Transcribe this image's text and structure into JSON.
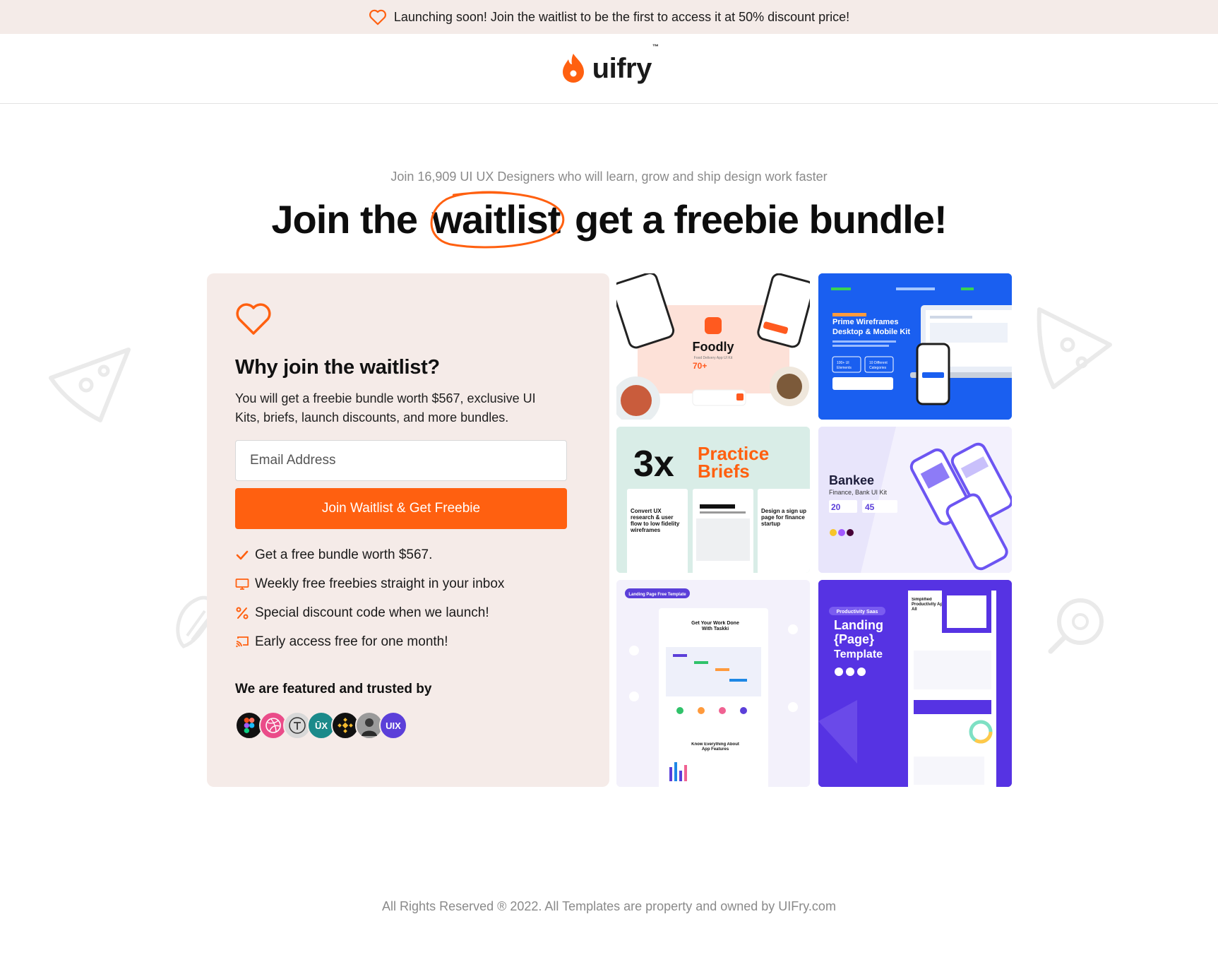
{
  "announcement": {
    "text": "Launching soon! Join the waitlist to be the first to access it at 50% discount price!",
    "icon": "heart-outline-icon"
  },
  "brand": {
    "name": "uifry",
    "trademark": "™",
    "accent": "#ff6010"
  },
  "hero": {
    "subline": "Join 16,909 UI UX Designers who will learn, grow and ship design work faster",
    "headline_before": "Join the",
    "headline_circled": "waitlist",
    "headline_after": "get a freebie bundle!"
  },
  "signup": {
    "heading": "Why join the waitlist?",
    "description": "You will get a freebie bundle worth $567, exclusive UI Kits, briefs, launch discounts, and more bundles.",
    "email_placeholder": "Email Address",
    "email_value": "",
    "button_label": "Join Waitlist & Get Freebie",
    "perks": [
      {
        "icon": "check-icon",
        "text": "Get a free bundle worth $567."
      },
      {
        "icon": "monitor-icon",
        "text": "Weekly free freebies straight in your inbox"
      },
      {
        "icon": "percent-icon",
        "text": "Special discount code when we launch!"
      },
      {
        "icon": "cast-icon",
        "text": "Early access free for one month!"
      }
    ],
    "featured_heading": "We are featured and trusted by",
    "featured_logos": [
      "figma",
      "dribbble",
      "typography",
      "ux",
      "binance",
      "person",
      "uix"
    ],
    "featured_uix_text": "UIX",
    "featured_ux_text": "ŪX"
  },
  "previews": {
    "foodly": {
      "title": "Foodly",
      "subtitle": "Food Delivery App UI Kit",
      "stat": "70+"
    },
    "wireframes": {
      "title": "Prime Wireframes",
      "title2": "Desktop & Mobile Kit",
      "stat1": "100+ UI",
      "stat1b": "Elements",
      "stat2": "10 Different",
      "stat2b": "Categories"
    },
    "briefs": {
      "big": "3x",
      "title1": "Practice",
      "title2": "Briefs",
      "card1": "Convert UX research & user flow to low fidelity wireframes",
      "card2": "Design a sign up page for finance startup"
    },
    "bankee": {
      "title": "Bankee",
      "subtitle": "Finance, Bank UI Kit",
      "n1": "20",
      "n2": "45"
    },
    "landing_left": {
      "badge": "Landing Page Free Template",
      "hero": "Get Your Work Done With Taskki",
      "mid": "Know Everything About App Features"
    },
    "landing_right": {
      "badge": "Productivity Saas",
      "line1": "Landing",
      "line2": "{Page}",
      "line3": "Template",
      "hero": "Simplified Productivity App For All"
    }
  },
  "footer": {
    "text": "All Rights Reserved ® 2022. All Templates are property and owned by UIFry.com"
  }
}
